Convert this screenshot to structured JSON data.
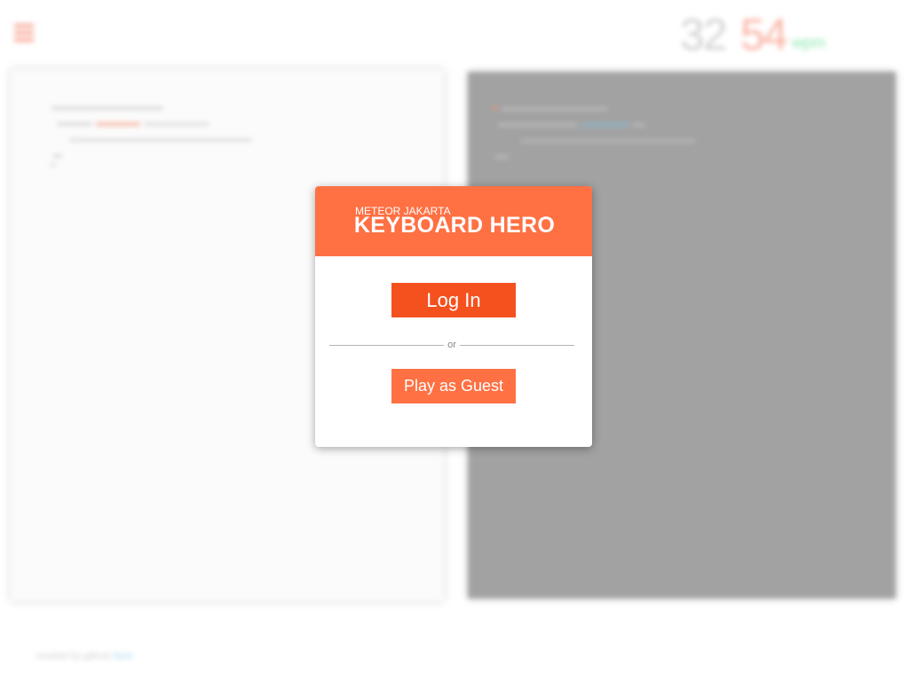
{
  "background": {
    "stats": {
      "value_a": "32",
      "value_b": "54",
      "unit": "wpm"
    },
    "footer": {
      "text": "created by github ",
      "link": "here"
    }
  },
  "modal": {
    "subtitle": "METEOR JAKARTA",
    "title": "KEYBOARD HERO",
    "login_label": "Log In",
    "divider_label": "or",
    "guest_label": "Play as Guest"
  },
  "colors": {
    "header": "#ff7043",
    "login_button": "#f4511e",
    "guest_button": "#ff7043"
  }
}
